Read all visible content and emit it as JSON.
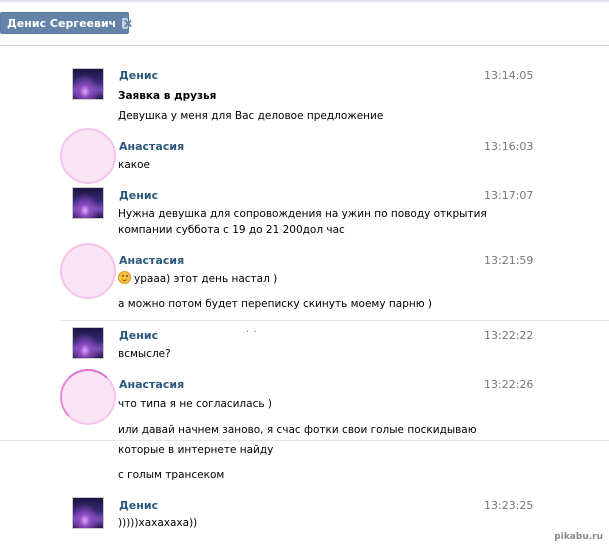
{
  "tab": {
    "label": "Денис Сергеевич"
  },
  "messages": [
    {
      "author": "Денис",
      "time": "13:14:05",
      "lines": [
        "Заявка в друзья",
        "Девушка у меня для Вас деловое предложение"
      ]
    },
    {
      "author": "Анастасия",
      "time": "13:16:03",
      "lines": [
        "какое"
      ]
    },
    {
      "author": "Денис",
      "time": "13:17:07",
      "lines": [
        "Нужна девушка для сопровождения на ужин по поводу открытия",
        "компании суббота с 19 до 21 200дол час"
      ]
    },
    {
      "author": "Анастасия",
      "time": "13:21:59",
      "lines": [
        "урааа) этот день настал )",
        "а можно потом будет переписку скинуть моему парню )"
      ]
    },
    {
      "author": "Денис",
      "time": "13:22:22",
      "lines": [
        "всмысле?"
      ]
    },
    {
      "author": "Анастасия",
      "time": "13:22:26",
      "lines": [
        "что типа я не согласилась )",
        "или давай начнем заново, я счас фотки свои голые поскидываю",
        "которые в интернете найду",
        "с голым трансеком"
      ]
    },
    {
      "author": "Денис",
      "time": "13:23:25",
      "lines": [
        ")))))хахахаха))"
      ]
    }
  ],
  "watermark": "pikabu.ru"
}
